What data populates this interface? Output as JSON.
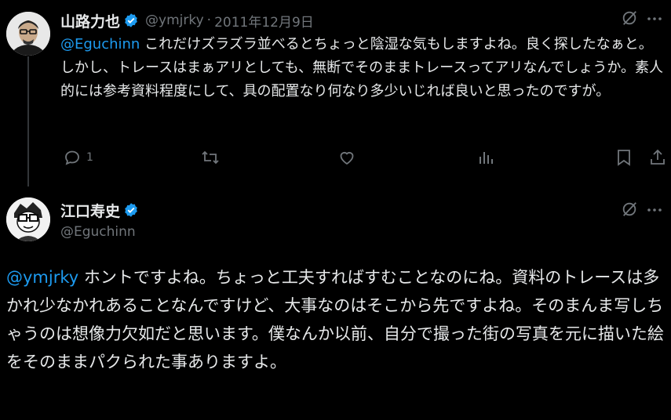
{
  "tweet1": {
    "name": "山路力也",
    "handle": "@ymjrky",
    "sep": "·",
    "date": "2011年12月9日",
    "mention": "@Eguchinn",
    "body": " これだけズラズラ並べるとちょっと陰湿な気もしますよね。良く探したなぁと。しかし、トレースはまぁアリとしても、無断でそのままトレースってアリなんでしょうか。素人的には参考資料程度にして、具の配置なり何なり多少いじれば良いと思ったのですが。",
    "reply_count": "1"
  },
  "tweet2": {
    "name": "江口寿史",
    "handle": "@Eguchinn",
    "mention": "@ymjrky",
    "body": " ホントですよね。ちょっと工夫すればすむことなのにね。資料のトレースは多かれ少なかれあることなんですけど、大事なのはそこから先ですよね。そのまんま写しちゃうのは想像力欠如だと思います。僕なんか以前、自分で撮った街の写真を元に描いた絵をそのままパクられた事ありますよ。"
  },
  "icons": [
    "grok-icon",
    "more-icon",
    "reply-icon",
    "retweet-icon",
    "like-icon",
    "views-icon",
    "bookmark-icon",
    "share-icon",
    "verified-icon"
  ],
  "colors": {
    "background": "#000000",
    "text": "#e7e9ea",
    "muted": "#71767b",
    "accent": "#1d9bf0"
  }
}
